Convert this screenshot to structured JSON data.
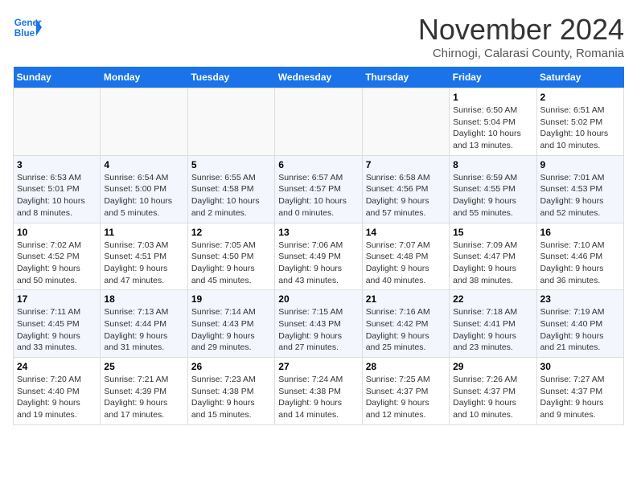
{
  "header": {
    "logo_line1": "General",
    "logo_line2": "Blue",
    "month_title": "November 2024",
    "subtitle": "Chirnogi, Calarasi County, Romania"
  },
  "weekdays": [
    "Sunday",
    "Monday",
    "Tuesday",
    "Wednesday",
    "Thursday",
    "Friday",
    "Saturday"
  ],
  "weeks": [
    [
      {
        "day": "",
        "info": ""
      },
      {
        "day": "",
        "info": ""
      },
      {
        "day": "",
        "info": ""
      },
      {
        "day": "",
        "info": ""
      },
      {
        "day": "",
        "info": ""
      },
      {
        "day": "1",
        "info": "Sunrise: 6:50 AM\nSunset: 5:04 PM\nDaylight: 10 hours\nand 13 minutes."
      },
      {
        "day": "2",
        "info": "Sunrise: 6:51 AM\nSunset: 5:02 PM\nDaylight: 10 hours\nand 10 minutes."
      }
    ],
    [
      {
        "day": "3",
        "info": "Sunrise: 6:53 AM\nSunset: 5:01 PM\nDaylight: 10 hours\nand 8 minutes."
      },
      {
        "day": "4",
        "info": "Sunrise: 6:54 AM\nSunset: 5:00 PM\nDaylight: 10 hours\nand 5 minutes."
      },
      {
        "day": "5",
        "info": "Sunrise: 6:55 AM\nSunset: 4:58 PM\nDaylight: 10 hours\nand 2 minutes."
      },
      {
        "day": "6",
        "info": "Sunrise: 6:57 AM\nSunset: 4:57 PM\nDaylight: 10 hours\nand 0 minutes."
      },
      {
        "day": "7",
        "info": "Sunrise: 6:58 AM\nSunset: 4:56 PM\nDaylight: 9 hours\nand 57 minutes."
      },
      {
        "day": "8",
        "info": "Sunrise: 6:59 AM\nSunset: 4:55 PM\nDaylight: 9 hours\nand 55 minutes."
      },
      {
        "day": "9",
        "info": "Sunrise: 7:01 AM\nSunset: 4:53 PM\nDaylight: 9 hours\nand 52 minutes."
      }
    ],
    [
      {
        "day": "10",
        "info": "Sunrise: 7:02 AM\nSunset: 4:52 PM\nDaylight: 9 hours\nand 50 minutes."
      },
      {
        "day": "11",
        "info": "Sunrise: 7:03 AM\nSunset: 4:51 PM\nDaylight: 9 hours\nand 47 minutes."
      },
      {
        "day": "12",
        "info": "Sunrise: 7:05 AM\nSunset: 4:50 PM\nDaylight: 9 hours\nand 45 minutes."
      },
      {
        "day": "13",
        "info": "Sunrise: 7:06 AM\nSunset: 4:49 PM\nDaylight: 9 hours\nand 43 minutes."
      },
      {
        "day": "14",
        "info": "Sunrise: 7:07 AM\nSunset: 4:48 PM\nDaylight: 9 hours\nand 40 minutes."
      },
      {
        "day": "15",
        "info": "Sunrise: 7:09 AM\nSunset: 4:47 PM\nDaylight: 9 hours\nand 38 minutes."
      },
      {
        "day": "16",
        "info": "Sunrise: 7:10 AM\nSunset: 4:46 PM\nDaylight: 9 hours\nand 36 minutes."
      }
    ],
    [
      {
        "day": "17",
        "info": "Sunrise: 7:11 AM\nSunset: 4:45 PM\nDaylight: 9 hours\nand 33 minutes."
      },
      {
        "day": "18",
        "info": "Sunrise: 7:13 AM\nSunset: 4:44 PM\nDaylight: 9 hours\nand 31 minutes."
      },
      {
        "day": "19",
        "info": "Sunrise: 7:14 AM\nSunset: 4:43 PM\nDaylight: 9 hours\nand 29 minutes."
      },
      {
        "day": "20",
        "info": "Sunrise: 7:15 AM\nSunset: 4:43 PM\nDaylight: 9 hours\nand 27 minutes."
      },
      {
        "day": "21",
        "info": "Sunrise: 7:16 AM\nSunset: 4:42 PM\nDaylight: 9 hours\nand 25 minutes."
      },
      {
        "day": "22",
        "info": "Sunrise: 7:18 AM\nSunset: 4:41 PM\nDaylight: 9 hours\nand 23 minutes."
      },
      {
        "day": "23",
        "info": "Sunrise: 7:19 AM\nSunset: 4:40 PM\nDaylight: 9 hours\nand 21 minutes."
      }
    ],
    [
      {
        "day": "24",
        "info": "Sunrise: 7:20 AM\nSunset: 4:40 PM\nDaylight: 9 hours\nand 19 minutes."
      },
      {
        "day": "25",
        "info": "Sunrise: 7:21 AM\nSunset: 4:39 PM\nDaylight: 9 hours\nand 17 minutes."
      },
      {
        "day": "26",
        "info": "Sunrise: 7:23 AM\nSunset: 4:38 PM\nDaylight: 9 hours\nand 15 minutes."
      },
      {
        "day": "27",
        "info": "Sunrise: 7:24 AM\nSunset: 4:38 PM\nDaylight: 9 hours\nand 14 minutes."
      },
      {
        "day": "28",
        "info": "Sunrise: 7:25 AM\nSunset: 4:37 PM\nDaylight: 9 hours\nand 12 minutes."
      },
      {
        "day": "29",
        "info": "Sunrise: 7:26 AM\nSunset: 4:37 PM\nDaylight: 9 hours\nand 10 minutes."
      },
      {
        "day": "30",
        "info": "Sunrise: 7:27 AM\nSunset: 4:37 PM\nDaylight: 9 hours\nand 9 minutes."
      }
    ]
  ]
}
